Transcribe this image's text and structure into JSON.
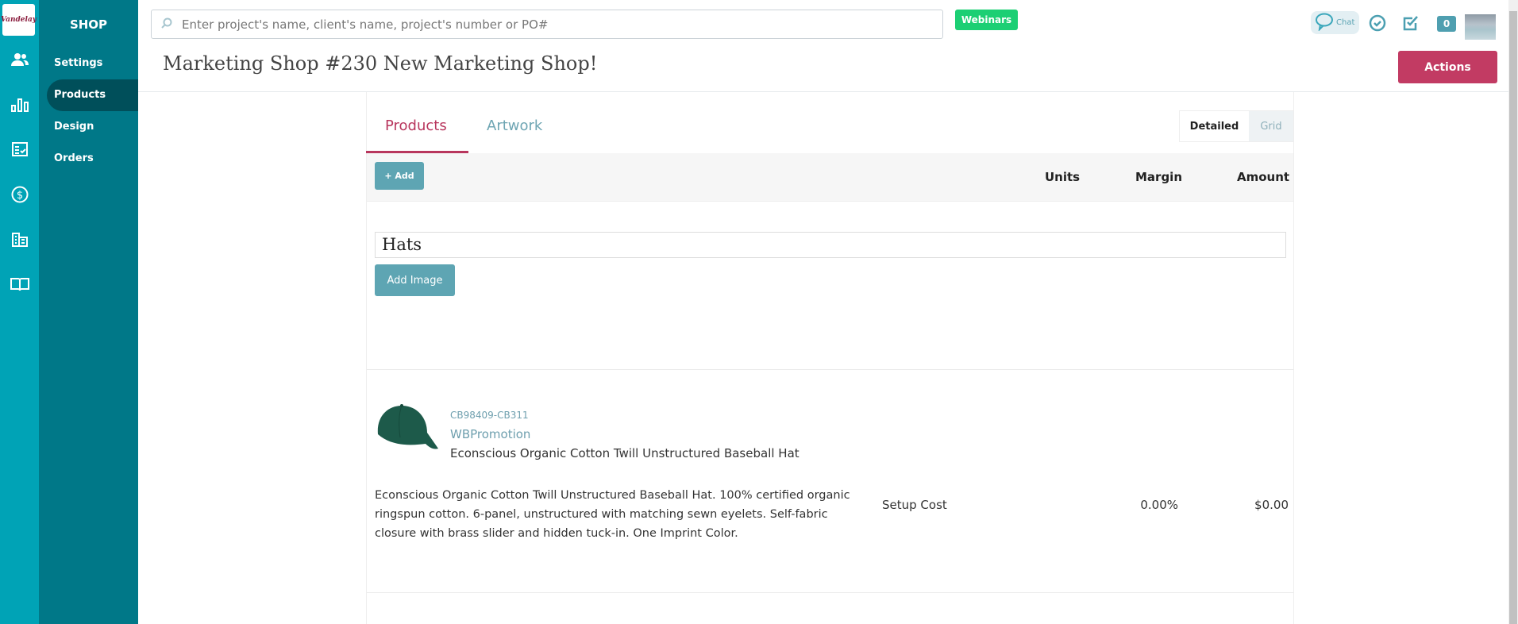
{
  "brand": {
    "logo_text": "Vandelay"
  },
  "colors": {
    "rail": "#00a3b6",
    "subnav": "#007888",
    "accent": "#c23b63",
    "teal_button": "#5ea5b3",
    "webinars": "#1ccf74"
  },
  "rail_icons": [
    "users-icon",
    "bar-chart-icon",
    "checklist-icon",
    "dollar-icon",
    "building-icon",
    "book-icon"
  ],
  "subnav": {
    "title": "SHOP",
    "items": [
      {
        "label": "Settings"
      },
      {
        "label": "Products",
        "active": true
      },
      {
        "label": "Design"
      },
      {
        "label": "Orders"
      }
    ]
  },
  "header": {
    "search_placeholder": "Enter project's name, client's name, project's number or PO#",
    "webinars": "Webinars",
    "chat": "Chat",
    "notification_count": "0",
    "title": "Marketing Shop #230 New Marketing Shop!",
    "actions": "Actions"
  },
  "tabs": [
    {
      "label": "Products",
      "active": true
    },
    {
      "label": "Artwork"
    }
  ],
  "view_toggle": {
    "detailed": "Detailed",
    "grid": "Grid",
    "selected": "Detailed"
  },
  "table": {
    "add_label": "+ Add",
    "columns": [
      "Units",
      "Margin",
      "Amount"
    ]
  },
  "section": {
    "title": "Hats",
    "add_image": "Add Image"
  },
  "product": {
    "sku": "CB98409-CB311",
    "supplier": "WBPromotion",
    "name": "Econscious Organic Cotton Twill Unstructured Baseball Hat",
    "description": "Econscious Organic Cotton Twill Unstructured Baseball Hat. 100% certified organic ringspun cotton. 6-panel, unstructured with matching sewn eyelets. Self-fabric closure with brass slider and hidden tuck-in. One Imprint Color.",
    "line_item": "Setup Cost",
    "margin": "0.00%",
    "amount": "$0.00"
  }
}
